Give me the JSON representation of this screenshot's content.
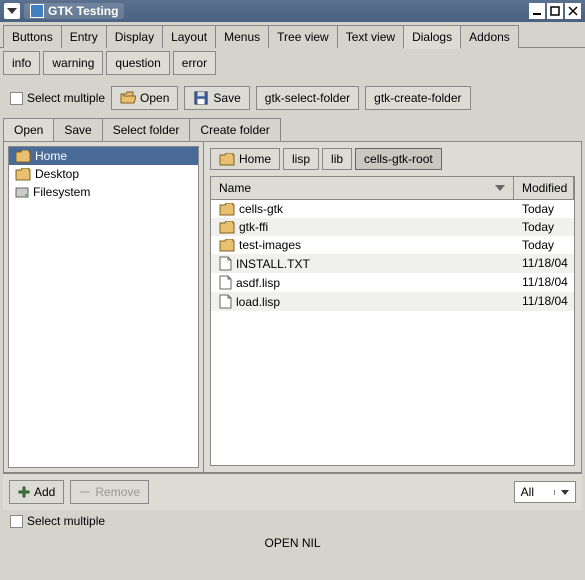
{
  "window": {
    "title": "GTK Testing"
  },
  "tabs": [
    "Buttons",
    "Entry",
    "Display",
    "Layout",
    "Menus",
    "Tree view",
    "Text view",
    "Dialogs",
    "Addons"
  ],
  "activeTab": 7,
  "subtabs": [
    "info",
    "warning",
    "question",
    "error"
  ],
  "toolbar": {
    "selectMultiple": "Select multiple",
    "open": "Open",
    "save": "Save",
    "selectFolder": "gtk-select-folder",
    "createFolder": "gtk-create-folder"
  },
  "fileTabs": [
    "Open",
    "Save",
    "Select folder",
    "Create folder"
  ],
  "activeFileTab": 0,
  "sidebar": [
    {
      "label": "Home",
      "icon": "folder"
    },
    {
      "label": "Desktop",
      "icon": "folder"
    },
    {
      "label": "Filesystem",
      "icon": "disk"
    }
  ],
  "breadcrumb": [
    {
      "label": "Home",
      "icon": true
    },
    {
      "label": "lisp",
      "icon": false
    },
    {
      "label": "lib",
      "icon": false
    },
    {
      "label": "cells-gtk-root",
      "icon": false
    }
  ],
  "fileHeader": {
    "name": "Name",
    "modified": "Modified"
  },
  "files": [
    {
      "name": "cells-gtk",
      "type": "folder",
      "modified": "Today"
    },
    {
      "name": "gtk-ffi",
      "type": "folder",
      "modified": "Today"
    },
    {
      "name": "test-images",
      "type": "folder",
      "modified": "Today"
    },
    {
      "name": "INSTALL.TXT",
      "type": "file",
      "modified": "11/18/04"
    },
    {
      "name": "asdf.lisp",
      "type": "file",
      "modified": "11/18/04"
    },
    {
      "name": "load.lisp",
      "type": "file",
      "modified": "11/18/04"
    }
  ],
  "bottom": {
    "add": "Add",
    "remove": "Remove",
    "filter": "All"
  },
  "footer": {
    "selectMultiple": "Select multiple",
    "status": "OPEN NIL"
  }
}
